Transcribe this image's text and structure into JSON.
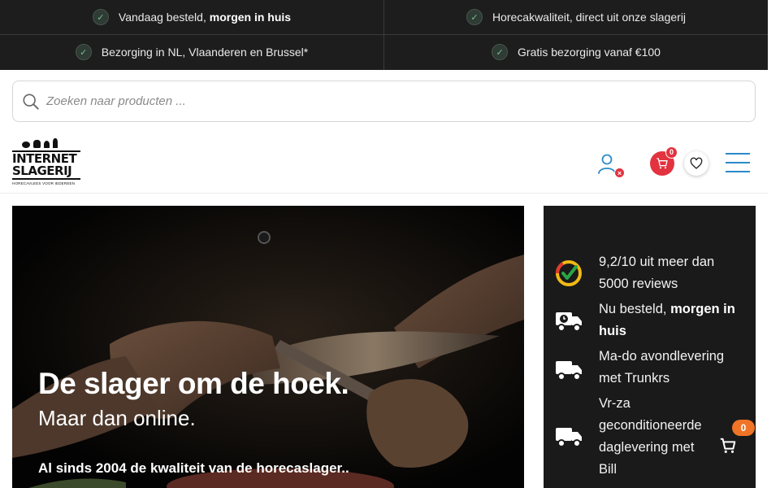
{
  "usp": [
    {
      "text": "Vandaag besteld, ",
      "bold": "morgen in huis"
    },
    {
      "text": "Horecakwaliteit, direct uit onze slagerij",
      "bold": ""
    },
    {
      "text": "Bezorging in NL, Vlaanderen en Brussel*",
      "bold": ""
    },
    {
      "text": "Gratis bezorging vanaf €100",
      "bold": ""
    }
  ],
  "search": {
    "placeholder": "Zoeken naar producten ..."
  },
  "logo": {
    "line1": "INTERNET",
    "line2": "SLAGERIJ",
    "tagline": "HORECAVLEES VOOR IEDEREEN"
  },
  "header": {
    "cart_count": "0",
    "user_badge": "×"
  },
  "hero": {
    "title": "De slager om de hoek.",
    "subtitle": "Maar dan online.",
    "tagline": "Al sinds 2004 de kwaliteit van de horecaslager.."
  },
  "side": {
    "items": [
      {
        "text": "9,2/10 uit meer dan 5000 reviews",
        "bold": "",
        "icon": "kiyoh-rating-icon"
      },
      {
        "text": "Nu besteld, ",
        "bold": "morgen in huis",
        "icon": "delivery-truck-clock-icon"
      },
      {
        "text": "Ma-do avondlevering met Trunkrs",
        "bold": "",
        "icon": "delivery-truck-icon"
      },
      {
        "text": "Vr-za geconditioneerde daglevering met Bill",
        "bold": "",
        "icon": "delivery-truck-icon"
      }
    ]
  },
  "floating_cart": {
    "count": "0"
  },
  "colors": {
    "accent_red": "#e2333f",
    "accent_blue": "#2b8ac9",
    "badge_orange": "#f07427",
    "dark_bar": "#1d1d1d"
  }
}
